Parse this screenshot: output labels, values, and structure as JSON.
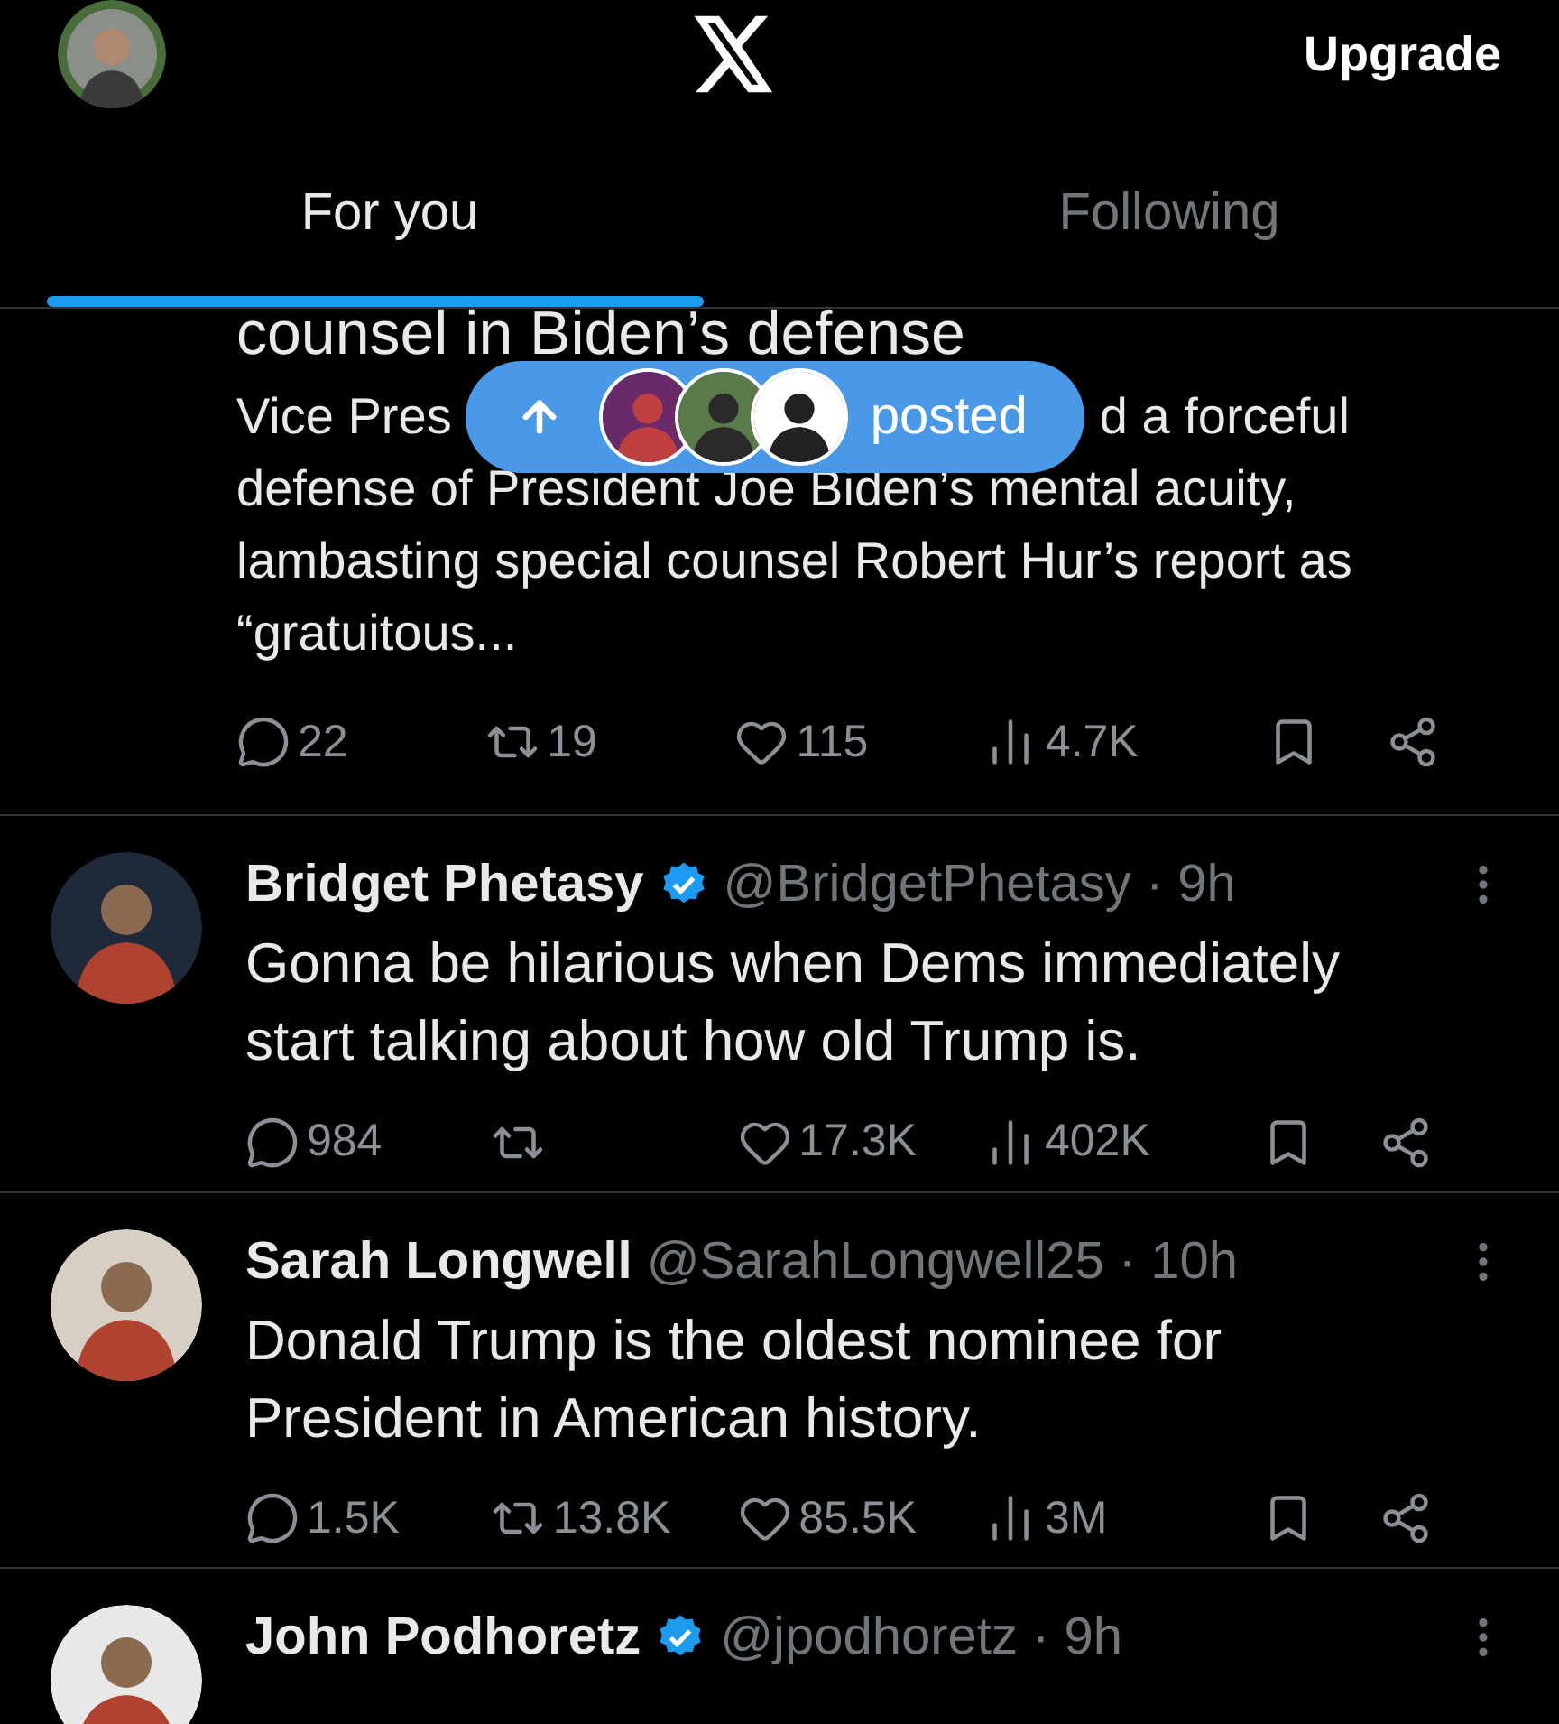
{
  "header": {
    "upgrade": "Upgrade"
  },
  "tabs": [
    {
      "label": "For you",
      "selected": true
    },
    {
      "label": "Following",
      "selected": false
    }
  ],
  "new_posts_pill": {
    "label": "posted"
  },
  "partial_post": {
    "headline": "counsel in Biden’s defense",
    "before_pill": "Vice Pres",
    "after_pill": "d a forceful",
    "lines": [
      "defense of President Joe Biden’s mental acuity,",
      "lambasting special counsel Robert Hur’s report as",
      "“gratuitous..."
    ],
    "actions": [
      {
        "kind": "reply",
        "count": "22"
      },
      {
        "kind": "repost",
        "count": "19"
      },
      {
        "kind": "like",
        "count": "115"
      },
      {
        "kind": "views",
        "count": "4.7K"
      },
      {
        "kind": "bookmark"
      },
      {
        "kind": "share"
      }
    ]
  },
  "posts": [
    {
      "name": "Bridget Phetasy",
      "verified": true,
      "meta": "@BridgetPhetasy · 9h",
      "text": "Gonna be hilarious when Dems immediately start talking about how old Trump is.",
      "actions": [
        {
          "kind": "reply",
          "count": "984"
        },
        {
          "kind": "repost"
        },
        {
          "kind": "like",
          "count": "17.3K"
        },
        {
          "kind": "views",
          "count": "402K"
        },
        {
          "kind": "bookmark"
        },
        {
          "kind": "share"
        }
      ]
    },
    {
      "name": "Sarah Longwell",
      "verified": false,
      "meta": "@SarahLongwell25 · 10h",
      "text": "Donald Trump is the oldest nominee for President in American history.",
      "actions": [
        {
          "kind": "reply",
          "count": "1.5K"
        },
        {
          "kind": "repost",
          "count": "13.8K"
        },
        {
          "kind": "like",
          "count": "85.5K"
        },
        {
          "kind": "views",
          "count": "3M"
        },
        {
          "kind": "bookmark"
        },
        {
          "kind": "share"
        }
      ]
    },
    {
      "name": "John Podhoretz",
      "verified": true,
      "meta": "@jpodhoretz · 9h"
    }
  ]
}
